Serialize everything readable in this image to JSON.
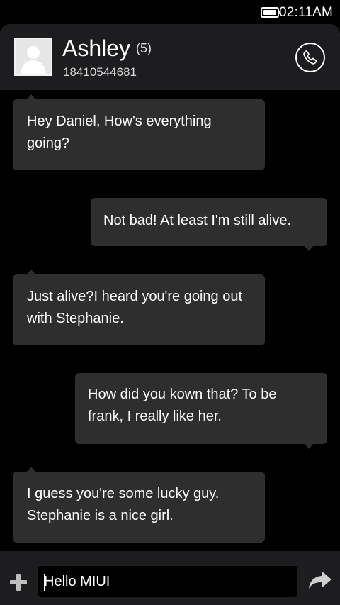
{
  "status_bar": {
    "time": "02:11AM",
    "battery_icon": "battery-icon"
  },
  "header": {
    "contact_name": "Ashley",
    "unread_count": "(5)",
    "phone_number": "18410544681",
    "avatar_icon": "default-avatar-icon",
    "call_icon": "phone-icon"
  },
  "messages": [
    {
      "direction": "incoming",
      "text": "Hey Daniel, How's everything going?"
    },
    {
      "direction": "outgoing",
      "text": "Not bad! At least I'm still alive."
    },
    {
      "direction": "incoming",
      "text": "Just  alive?I heard you're going out with Stephanie."
    },
    {
      "direction": "outgoing",
      "text": "How did you kown that? To be frank, I really like her."
    },
    {
      "direction": "incoming",
      "text": "I guess you're some lucky guy. Stephanie is a nice girl."
    }
  ],
  "composer": {
    "value": "Hello MIUI",
    "add_icon": "plus-icon",
    "send_icon": "send-arrow-icon"
  },
  "colors": {
    "background": "#000000",
    "bar": "#1d1d1f",
    "bubble": "#2e2e2e",
    "text": "#ffffff"
  }
}
